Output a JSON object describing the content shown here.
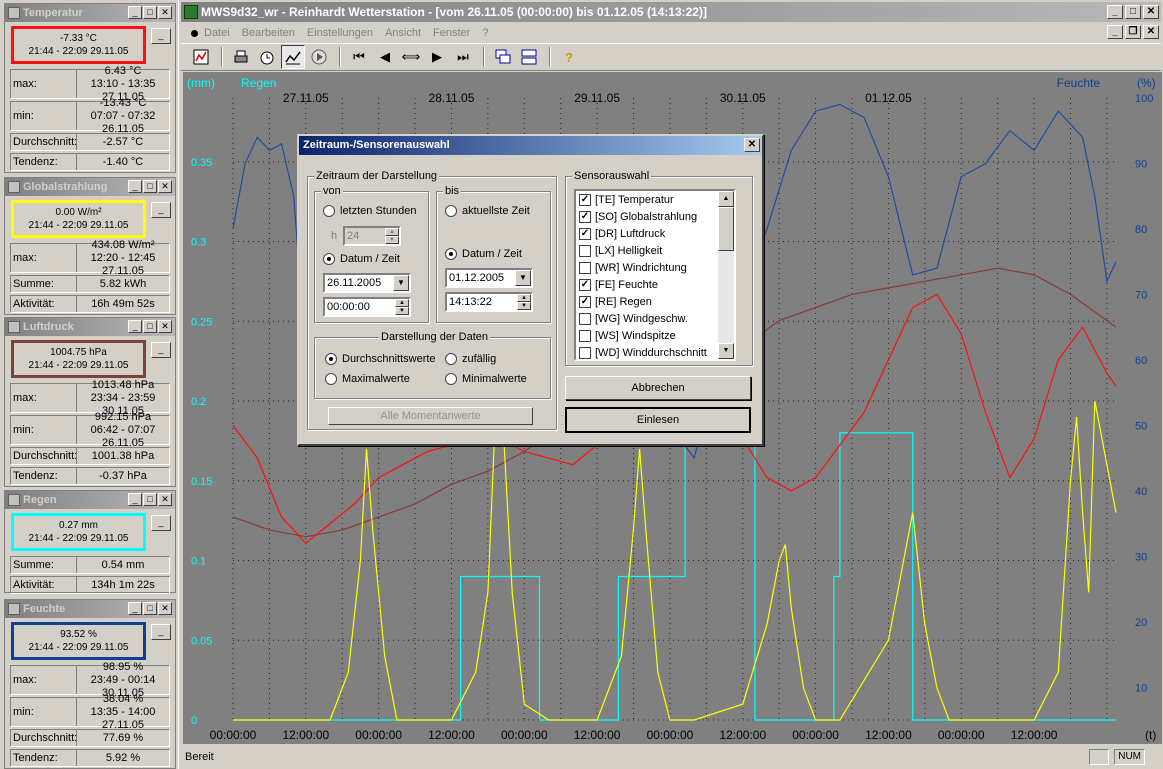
{
  "panels": [
    {
      "title": "Temperatur",
      "current": "-7.33 °C",
      "current_time": "21:44 - 22:09   29.11.05",
      "color": "#ff1010",
      "rows": [
        {
          "label": "max:",
          "v1": "6.43 °C",
          "v2": "13:10 - 13:35  27.11.05"
        },
        {
          "label": "min:",
          "v1": "-13.43 °C",
          "v2": "07:07 - 07:32  26.11.05"
        },
        {
          "label": "Durchschnitt:",
          "v1": "-2.57 °C"
        },
        {
          "label": "Tendenz:",
          "v1": "-1.40 °C"
        }
      ]
    },
    {
      "title": "Globalstrahlung",
      "current": "0.00 W/m²",
      "current_time": "21:44 - 22:09   29.11.05",
      "color": "#ffff00",
      "rows": [
        {
          "label": "max:",
          "v1": "434.08 W/m²",
          "v2": "12:20 - 12:45  27.11.05"
        },
        {
          "label": "Summe:",
          "v1": "5.82 kWh"
        },
        {
          "label": "Aktivität:",
          "v1": "16h 49m 52s"
        }
      ]
    },
    {
      "title": "Luftdruck",
      "current": "1004.75 hPa",
      "current_time": "21:44 - 22:09   29.11.05",
      "color": "#804040",
      "rows": [
        {
          "label": "max:",
          "v1": "1013.48 hPa",
          "v2": "23:34 - 23:59  30.11.05"
        },
        {
          "label": "min:",
          "v1": "992.15 hPa",
          "v2": "06:42 - 07:07  26.11.05"
        },
        {
          "label": "Durchschnitt:",
          "v1": "1001.38 hPa"
        },
        {
          "label": "Tendenz:",
          "v1": "-0.37 hPa"
        }
      ]
    },
    {
      "title": "Regen",
      "current": "0.27 mm",
      "current_time": "21:44 - 22:09   29.11.05",
      "color": "#00ffff",
      "rows": [
        {
          "label": "Summe:",
          "v1": "0.54 mm"
        },
        {
          "label": "Aktivität:",
          "v1": "134h 1m 22s"
        }
      ]
    },
    {
      "title": "Feuchte",
      "current": "93.52 %",
      "current_time": "21:44 - 22:09   29.11.05",
      "color": "#104090",
      "rows": [
        {
          "label": "max:",
          "v1": "98.95 %",
          "v2": "23:49 - 00:14  30.11.05"
        },
        {
          "label": "min:",
          "v1": "38.04 %",
          "v2": "13:35 - 14:00  27.11.05"
        },
        {
          "label": "Durchschnitt:",
          "v1": "77.69 %"
        },
        {
          "label": "Tendenz:",
          "v1": "5.92 %"
        }
      ]
    }
  ],
  "window": {
    "title": "MWS9d32_wr - Reinhardt Wetterstation - [vom 26.11.05 (00:00:00) bis 01.12.05 (14:13:22)]"
  },
  "menu": [
    "Datei",
    "Bearbeiten",
    "Einstellungen",
    "Ansicht",
    "Fenster",
    "?"
  ],
  "status": {
    "text": "Bereit",
    "num": "NUM"
  },
  "chart_data": {
    "type": "line",
    "left_unit": "(mm)",
    "left_series_label": "Regen",
    "right_unit": "(%)",
    "right_series_label": "Feuchte",
    "x_unit": "(t)",
    "dates": [
      "27.11.05",
      "28.11.05",
      "29.11.05",
      "30.11.05",
      "01.12.05"
    ],
    "x_ticks": [
      "00:00:00",
      "12:00:00",
      "00:00:00",
      "12:00:00",
      "00:00:00",
      "12:00:00",
      "00:00:00",
      "12:00:00",
      "00:00:00",
      "12:00:00",
      "00:00:00",
      "12:00:00"
    ],
    "y_left_ticks": [
      "0",
      "0.05",
      "0.1",
      "0.15",
      "0.2",
      "0.25",
      "0.3",
      "0.35"
    ],
    "y_right_ticks": [
      "10",
      "20",
      "30",
      "40",
      "50",
      "60",
      "70",
      "80",
      "90",
      "100"
    ],
    "ylim_left": [
      0,
      0.39
    ],
    "ylim_right": [
      5,
      100
    ],
    "xlim_hours": [
      -12,
      133.5
    ],
    "series": [
      {
        "color": "#00ffff",
        "axis": "left",
        "kind": "step",
        "x": [
          -12,
          25.5,
          25.5,
          38.5,
          38.5,
          51.5,
          51.5,
          62.5,
          62.5,
          74,
          74,
          87,
          87,
          88,
          88,
          100,
          100,
          108,
          108,
          133.5
        ],
        "y": [
          0,
          0,
          0.09,
          0.09,
          0,
          0,
          0.09,
          0.09,
          0.27,
          0.27,
          0,
          0,
          0.09,
          0.09,
          0.18,
          0.18,
          0,
          0,
          0,
          0
        ]
      },
      {
        "color": "#1f4f9f",
        "axis": "right",
        "kind": "line",
        "x": [
          -12,
          -10,
          -8,
          -6,
          -4,
          -2,
          0,
          4,
          8,
          12,
          16,
          20,
          24,
          28,
          32,
          36,
          40,
          44,
          48,
          52,
          56,
          60,
          64,
          68,
          72,
          76,
          80,
          84,
          88,
          92,
          96,
          100,
          104,
          108,
          112,
          116,
          120,
          124,
          128,
          130,
          132,
          133.5
        ],
        "y": [
          80,
          90,
          94,
          92,
          93,
          85,
          60,
          55,
          50,
          48,
          52,
          60,
          70,
          78,
          85,
          88,
          85,
          80,
          78,
          68,
          60,
          50,
          45,
          60,
          70,
          80,
          92,
          98,
          99,
          97,
          88,
          73,
          74,
          88,
          90,
          95,
          92,
          98,
          94,
          85,
          72,
          75
        ]
      },
      {
        "color": "#ff1010",
        "axis": "right",
        "kind": "line",
        "x": [
          -12,
          -8,
          -4,
          0,
          4,
          8,
          12,
          16,
          20,
          24,
          28,
          32,
          36,
          40,
          44,
          48,
          52,
          56,
          58,
          60,
          64,
          68,
          72,
          76,
          80,
          84,
          88,
          92,
          96,
          100,
          104,
          108,
          112,
          116,
          120,
          124,
          128,
          132,
          133.5
        ],
        "y": [
          50,
          45,
          36,
          32,
          35,
          38,
          42,
          44,
          46,
          47,
          48,
          48,
          46,
          45,
          44,
          47,
          49,
          54,
          56,
          63,
          62,
          55,
          48,
          42,
          40,
          42,
          47,
          52,
          60,
          68,
          70,
          64,
          52,
          42,
          48,
          60,
          65,
          58,
          56
        ]
      },
      {
        "color": "#8a3a3a",
        "axis": "right",
        "kind": "line",
        "x": [
          -12,
          -6,
          0,
          6,
          12,
          18,
          24,
          30,
          36,
          42,
          48,
          54,
          60,
          66,
          72,
          78,
          84,
          90,
          96,
          102,
          108,
          114,
          120,
          126,
          132,
          133.5
        ],
        "y": [
          36,
          34,
          33,
          34,
          36,
          38,
          41,
          43,
          46,
          50,
          53,
          56,
          58,
          60,
          62,
          66,
          68,
          70,
          71,
          72,
          73,
          74,
          73,
          70,
          66,
          65
        ]
      },
      {
        "color": "#ffff00",
        "axis": "left",
        "kind": "line",
        "x": [
          -12,
          4,
          7,
          9,
          10,
          11,
          13,
          15,
          16,
          19,
          24,
          28,
          30,
          31,
          32,
          34,
          36,
          40,
          48,
          52,
          54,
          55,
          56,
          58,
          60,
          64,
          72,
          76,
          78,
          79,
          80,
          82,
          84,
          88,
          96,
          100,
          102,
          104,
          106,
          108,
          112,
          116,
          120,
          124,
          125,
          126,
          127,
          128,
          129,
          130,
          133.5
        ],
        "y": [
          0,
          0,
          0.03,
          0.1,
          0.17,
          0.12,
          0.04,
          0,
          0,
          0,
          0,
          0.03,
          0.08,
          0.17,
          0.22,
          0.08,
          0.01,
          0,
          0,
          0.04,
          0.12,
          0.17,
          0.12,
          0.03,
          0,
          0,
          0.01,
          0.06,
          0.1,
          0.11,
          0.07,
          0.02,
          0,
          0,
          0.05,
          0.13,
          0.06,
          0.02,
          0,
          0,
          0,
          0,
          0,
          0.03,
          0.09,
          0.15,
          0.19,
          0.13,
          0.08,
          0.2,
          0.13
        ]
      }
    ]
  },
  "dialog": {
    "title": "Zeitraum-/Sensorenauswahl",
    "group_zeitraum": "Zeitraum der Darstellung",
    "von": "von",
    "bis": "bis",
    "letzte_stunden": "letzten Stunden",
    "h_label": "h",
    "h_value": "24",
    "datum_zeit": "Datum / Zeit",
    "aktuellste_zeit": "aktuellste Zeit",
    "von_date": "26.11.2005",
    "von_time": "00:00:00",
    "bis_date": "01.12.2005",
    "bis_time": "14:13:22",
    "group_darstellung": "Darstellung der Daten",
    "durchschnitt": "Durchschnittswerte",
    "zufaellig": "zufällig",
    "maximal": "Maximalwerte",
    "minimal": "Minimalwerte",
    "alle": "Alle Momentanwerte",
    "group_sensor": "Sensorauswahl",
    "sensors": [
      {
        "label": "[TE] Temperatur",
        "checked": true
      },
      {
        "label": "[SO] Globalstrahlung",
        "checked": true
      },
      {
        "label": "[DR] Luftdruck",
        "checked": true
      },
      {
        "label": "[LX] Helligkeit",
        "checked": false
      },
      {
        "label": "[WR] Windrichtung",
        "checked": false
      },
      {
        "label": "[FE] Feuchte",
        "checked": true
      },
      {
        "label": "[RE] Regen",
        "checked": true
      },
      {
        "label": "[WG] Windgeschw.",
        "checked": false
      },
      {
        "label": "[WS] Windspitze",
        "checked": false
      },
      {
        "label": "[WD] Winddurchschnitt",
        "checked": false
      }
    ],
    "abbrechen": "Abbrechen",
    "einlesen": "Einlesen"
  }
}
